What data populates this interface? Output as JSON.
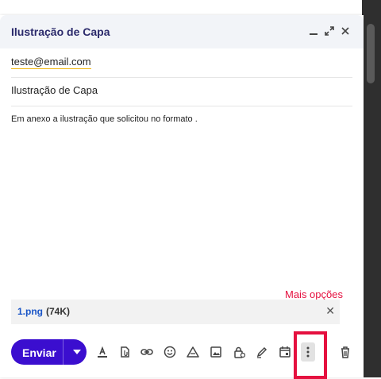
{
  "compose": {
    "title": "Ilustração de Capa",
    "to": "teste@email.com",
    "subject": "Ilustração de Capa",
    "body": "Em anexo a ilustração que solicitou no formato ."
  },
  "hint": {
    "label": "Mais opções",
    "color": "#e5103f"
  },
  "attachment": {
    "name": "1.png",
    "size": "(74K)"
  },
  "toolbar": {
    "send_label": "Enviar",
    "send_color": "#3b0ecf",
    "icons": [
      "formatting-icon",
      "attach-file-icon",
      "link-icon",
      "emoji-icon",
      "drive-icon",
      "image-icon",
      "confidential-lock-icon",
      "signature-pen-icon",
      "schedule-calendar-icon",
      "more-options-icon",
      "trash-icon"
    ]
  }
}
